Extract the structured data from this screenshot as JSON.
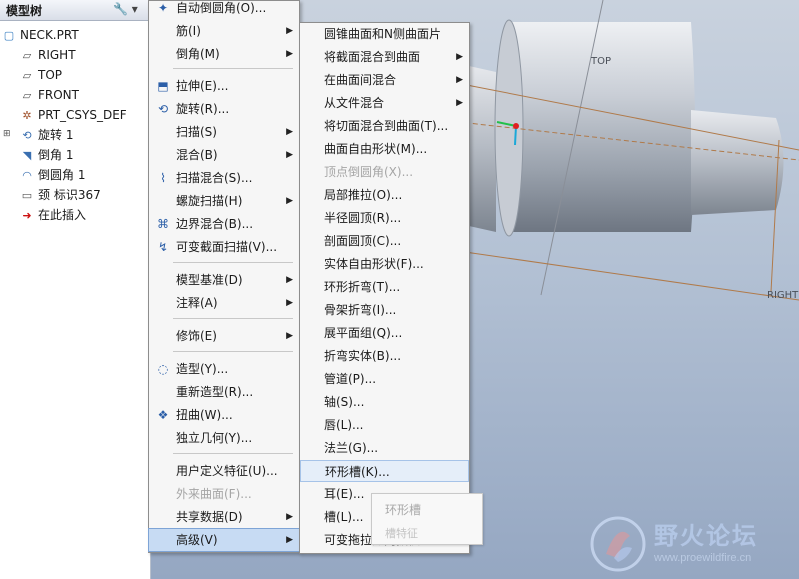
{
  "model_tree": {
    "title": "模型树",
    "tools": "🔧 ▾",
    "items": [
      {
        "label": "NECK.PRT",
        "icon": "part-icon"
      },
      {
        "label": "RIGHT",
        "icon": "datum-plane-icon"
      },
      {
        "label": "TOP",
        "icon": "datum-plane-icon"
      },
      {
        "label": "FRONT",
        "icon": "datum-plane-icon"
      },
      {
        "label": "PRT_CSYS_DEF",
        "icon": "csys-icon"
      },
      {
        "label": "旋转 1",
        "icon": "revolve-icon"
      },
      {
        "label": "倒角 1",
        "icon": "chamfer-icon"
      },
      {
        "label": "倒圆角 1",
        "icon": "round-icon"
      },
      {
        "label": "颈 标识367",
        "icon": "neck-icon"
      },
      {
        "label": "在此插入",
        "icon": "insert-here-icon"
      }
    ]
  },
  "main_menu": {
    "items": [
      {
        "label": "自动倒圆角(O)...",
        "icon": "auto-round-icon"
      },
      {
        "label": "筋(I)",
        "submenu": true
      },
      {
        "label": "倒角(M)",
        "submenu": true
      },
      {
        "label": "拉伸(E)...",
        "icon": "extrude-icon"
      },
      {
        "label": "旋转(R)...",
        "icon": "revolve-icon"
      },
      {
        "label": "扫描(S)",
        "submenu": true
      },
      {
        "label": "混合(B)",
        "submenu": true
      },
      {
        "label": "扫描混合(S)...",
        "icon": "swept-blend-icon"
      },
      {
        "label": "螺旋扫描(H)",
        "submenu": true
      },
      {
        "label": "边界混合(B)...",
        "icon": "boundary-blend-icon"
      },
      {
        "label": "可变截面扫描(V)...",
        "icon": "variable-sweep-icon"
      },
      {
        "label": "模型基准(D)",
        "submenu": true
      },
      {
        "label": "注释(A)",
        "submenu": true
      },
      {
        "label": "修饰(E)",
        "submenu": true
      },
      {
        "label": "造型(Y)...",
        "icon": "style-icon"
      },
      {
        "label": "重新造型(R)..."
      },
      {
        "label": "扭曲(W)...",
        "icon": "warp-icon"
      },
      {
        "label": "独立几何(Y)..."
      },
      {
        "label": "用户定义特征(U)..."
      },
      {
        "label": "外来曲面(F)...",
        "disabled": true
      },
      {
        "label": "共享数据(D)",
        "submenu": true
      },
      {
        "label": "高级(V)",
        "submenu": true,
        "active": true
      }
    ]
  },
  "sub_menu": {
    "items": [
      {
        "label": "圆锥曲面和N侧曲面片"
      },
      {
        "label": "将截面混合到曲面",
        "submenu": true
      },
      {
        "label": "在曲面间混合",
        "submenu": true
      },
      {
        "label": "从文件混合",
        "submenu": true
      },
      {
        "label": "将切面混合到曲面(T)..."
      },
      {
        "label": "曲面自由形状(M)..."
      },
      {
        "label": "顶点倒圆角(X)...",
        "disabled": true
      },
      {
        "label": "局部推拉(O)..."
      },
      {
        "label": "半径圆顶(R)..."
      },
      {
        "label": "剖面圆顶(C)..."
      },
      {
        "label": "实体自由形状(F)..."
      },
      {
        "label": "环形折弯(T)..."
      },
      {
        "label": "骨架折弯(I)..."
      },
      {
        "label": "展平面组(Q)..."
      },
      {
        "label": "折弯实体(B)..."
      },
      {
        "label": "管道(P)..."
      },
      {
        "label": "轴(S)..."
      },
      {
        "label": "唇(L)..."
      },
      {
        "label": "法兰(G)..."
      },
      {
        "label": "环形槽(K)...",
        "hover": true
      },
      {
        "label": "耳(E)..."
      },
      {
        "label": "槽(L)..."
      },
      {
        "label": "可变拖拉方向拔模..."
      }
    ]
  },
  "tooltip": {
    "title": "环形槽",
    "body": "槽特征"
  },
  "viewport": {
    "labels": {
      "top": "TOP",
      "right": "RIGHT"
    }
  },
  "watermark": {
    "title": "野火论坛",
    "url": "www.proewildfire.cn"
  },
  "colors": {
    "menu_bg": "#f6f6f6",
    "menu_active": "#c7dbf3",
    "datum_line": "#b07a4a"
  }
}
